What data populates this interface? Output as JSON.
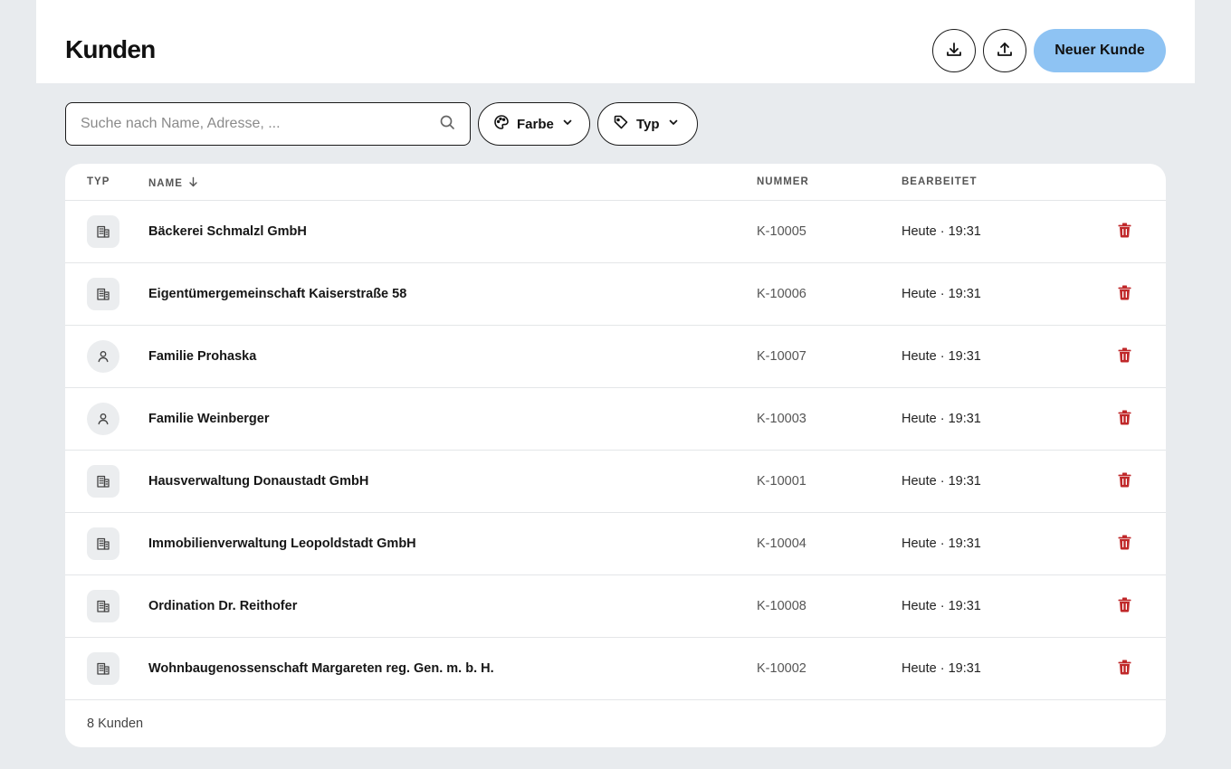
{
  "header": {
    "title": "Kunden",
    "download_icon": "download-icon",
    "upload_icon": "upload-icon",
    "new_button_label": "Neuer Kunde"
  },
  "toolbar": {
    "search_placeholder": "Suche nach Name, Adresse, ...",
    "search_value": "",
    "filter_color_label": "Farbe",
    "filter_type_label": "Typ"
  },
  "table": {
    "columns": {
      "type": "TYP",
      "name": "NAME",
      "number": "NUMMER",
      "edited": "BEARBEITET"
    },
    "sort": {
      "column": "name",
      "direction": "descending-arrow"
    },
    "rows": [
      {
        "type": "company",
        "name": "Bäckerei Schmalzl GmbH",
        "number": "K-10005",
        "edited": "Heute · 19:31"
      },
      {
        "type": "company",
        "name": "Eigentümergemeinschaft Kaiserstraße 58",
        "number": "K-10006",
        "edited": "Heute · 19:31"
      },
      {
        "type": "person",
        "name": "Familie Prohaska",
        "number": "K-10007",
        "edited": "Heute · 19:31"
      },
      {
        "type": "person",
        "name": "Familie Weinberger",
        "number": "K-10003",
        "edited": "Heute · 19:31"
      },
      {
        "type": "company",
        "name": "Hausverwaltung Donaustadt GmbH",
        "number": "K-10001",
        "edited": "Heute · 19:31"
      },
      {
        "type": "company",
        "name": "Immobilienverwaltung Leopoldstadt GmbH",
        "number": "K-10004",
        "edited": "Heute · 19:31"
      },
      {
        "type": "company",
        "name": "Ordination Dr. Reithofer",
        "number": "K-10008",
        "edited": "Heute · 19:31"
      },
      {
        "type": "company",
        "name": "Wohnbaugenossenschaft Margareten reg. Gen. m. b. H.",
        "number": "K-10002",
        "edited": "Heute · 19:31"
      }
    ],
    "footer_count": "8 Kunden"
  },
  "colors": {
    "primary": "#8ec3f3",
    "danger": "#c0282a",
    "background": "#e8ebee"
  }
}
